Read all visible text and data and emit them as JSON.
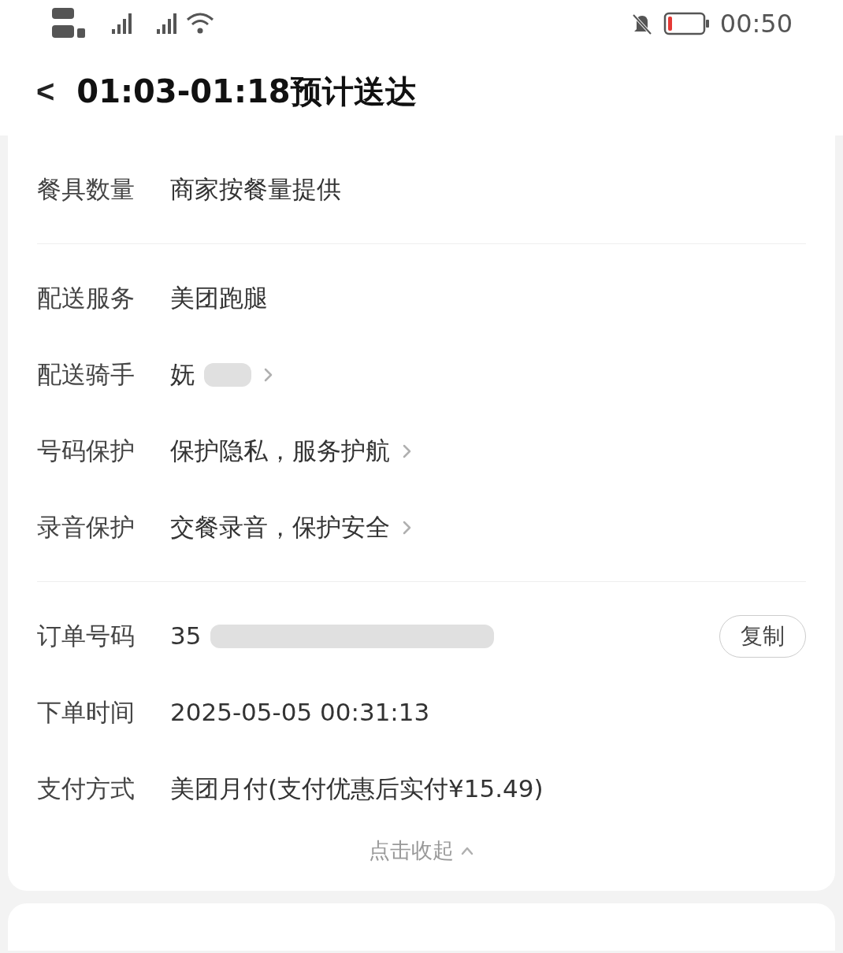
{
  "status_bar": {
    "time": "00:50"
  },
  "header": {
    "back": "<",
    "title": "01:03-01:18预计送达"
  },
  "sections": [
    {
      "rows": [
        {
          "label": "餐具数量",
          "value": "商家按餐量提供",
          "chevron": false,
          "redacted": false
        }
      ]
    },
    {
      "rows": [
        {
          "label": "配送服务",
          "value": "美团跑腿",
          "chevron": false,
          "redacted": false
        },
        {
          "label": "配送骑手",
          "value": "妩",
          "chevron": true,
          "redacted": true
        },
        {
          "label": "号码保护",
          "value": "保护隐私，服务护航",
          "chevron": true,
          "redacted": false
        },
        {
          "label": "录音保护",
          "value": "交餐录音，保护安全",
          "chevron": true,
          "redacted": false
        }
      ]
    },
    {
      "rows": [
        {
          "label": "订单号码",
          "value": "35",
          "chevron": false,
          "redacted": true,
          "action": "复制"
        },
        {
          "label": "下单时间",
          "value": "2025-05-05 00:31:13",
          "chevron": false,
          "redacted": false
        },
        {
          "label": "支付方式",
          "value": "美团月付(支付优惠后实付¥15.49)",
          "chevron": false,
          "redacted": false
        }
      ]
    }
  ],
  "collapse": {
    "label": "点击收起",
    "expanded": true
  }
}
